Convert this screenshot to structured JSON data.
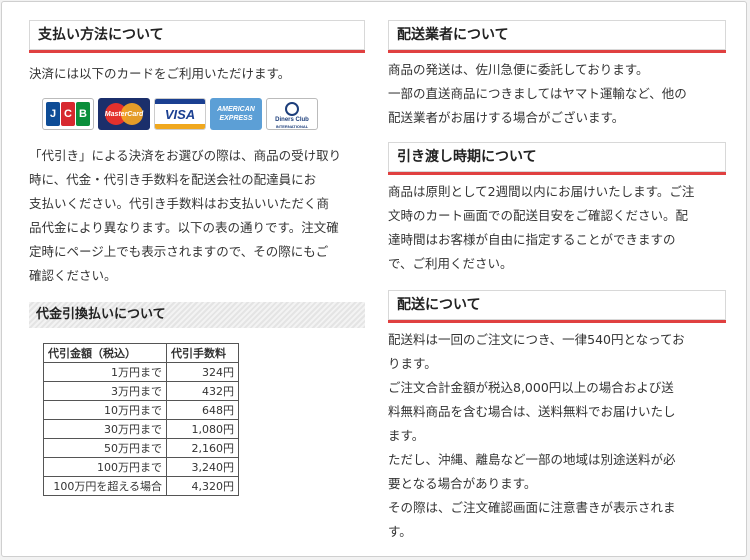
{
  "payment": {
    "title": "支払い方法について",
    "intro": "決済には以下のカードをご利用いただけます。",
    "cards": {
      "jcb": [
        "J",
        "C",
        "B"
      ],
      "mastercard": "MasterCard",
      "visa": "VISA",
      "amex_line1": "AMERICAN",
      "amex_line2": "EXPRESS",
      "diners_line1": "Diners Club",
      "diners_line2": "INTERNATIONAL"
    },
    "cod_lines": [
      "「代引き」による決済をお選びの際は、商品の受け取り",
      "時に、代金・代引き手数料を配送会社の配達員にお",
      "支払いください。代引き手数料はお支払いいただく商",
      "品代金により異なります。以下の表の通りです。注文確",
      "定時にページ上でも表示されますので、その際にもご",
      "確認ください。"
    ]
  },
  "cod": {
    "title": "代金引換払いについて",
    "headers": [
      "代引金額（税込）",
      "代引手数料"
    ],
    "rows": [
      [
        "1万円まで",
        "324円"
      ],
      [
        "3万円まで",
        "432円"
      ],
      [
        "10万円まで",
        "648円"
      ],
      [
        "30万円まで",
        "1,080円"
      ],
      [
        "50万円まで",
        "2,160円"
      ],
      [
        "100万円まで",
        "3,240円"
      ],
      [
        "100万円を超える場合",
        "4,320円"
      ]
    ]
  },
  "carrier": {
    "title": "配送業者について",
    "lines": [
      "商品の発送は、佐川急便に委託しております。",
      "一部の直送商品につきましてはヤマト運輸など、他の",
      "配送業者がお届けする場合がございます。"
    ]
  },
  "delivery_time": {
    "title": "引き渡し時期について",
    "lines": [
      "商品は原則として2週間以内にお届けいたします。ご注",
      "文時のカート画面での配送目安をご確認ください。配",
      "達時間はお客様が自由に指定することができますの",
      "で、ご利用ください。"
    ]
  },
  "shipping": {
    "title": "配送について",
    "lines": [
      "配送料は一回のご注文につき、一律540円となってお",
      "ります。",
      "ご注文合計金額が税込8,000円以上の場合および送",
      "料無料商品を含む場合は、送料無料でお届けいたし",
      "ます。",
      "ただし、沖縄、離島など一部の地域は別途送料が必",
      "要となる場合があります。",
      "その際は、ご注文確認画面に注意書きが表示されま",
      "す。"
    ]
  }
}
